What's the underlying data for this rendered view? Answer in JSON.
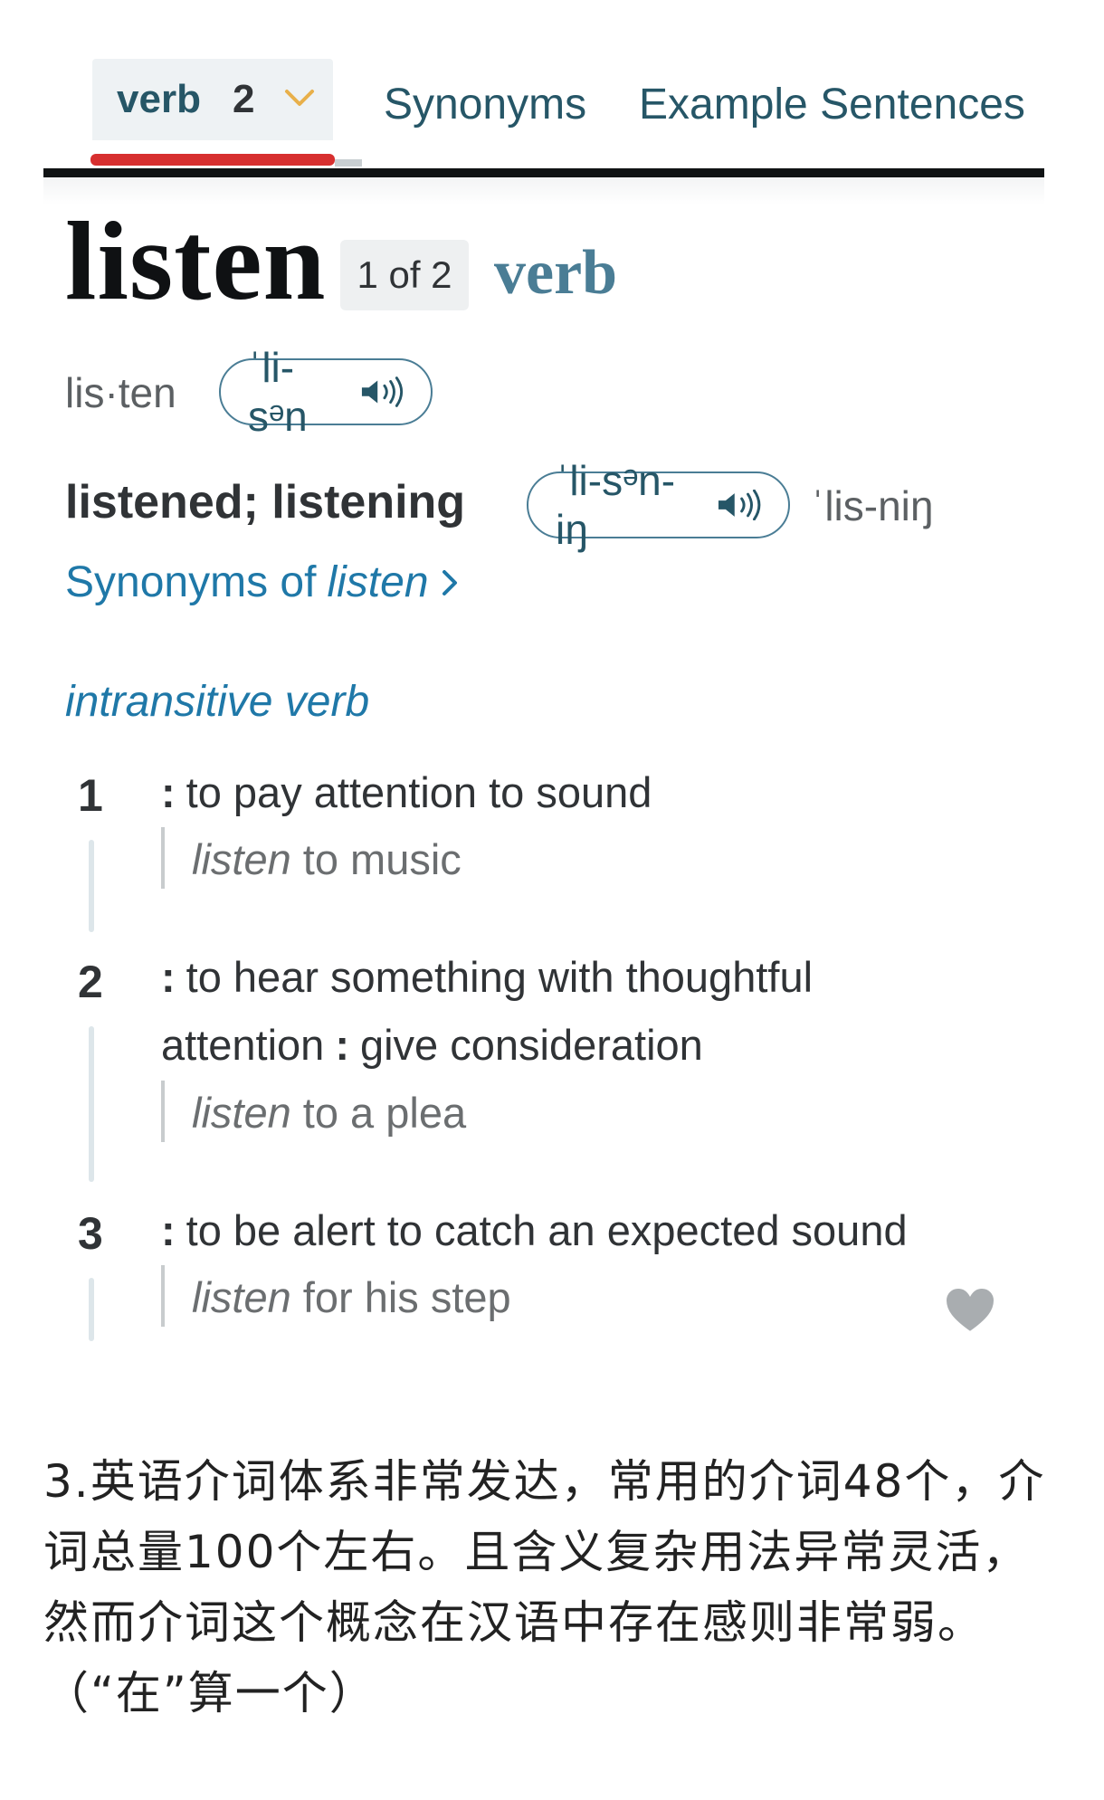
{
  "tabs": {
    "active": {
      "label": "verb",
      "count": "2"
    },
    "synonyms": "Synonyms",
    "examples": "Example Sentences"
  },
  "entry": {
    "headword": "listen",
    "entry_number": "1 of 2",
    "part_of_speech": "verb",
    "syllables": "lis·ten",
    "pronunciation": "ˈli-sᵊn",
    "inflections": "listened; listening",
    "inflection_pronunciation": "ˈli-sᵊn-iŋ",
    "alt_pronunciation": "ˈlis-niŋ",
    "synonyms_link": {
      "prefix": "Synonyms of",
      "word": "listen"
    }
  },
  "senses_label": "intransitive verb",
  "senses": [
    {
      "num": "1",
      "definition": "to pay attention to sound",
      "subdefinition": "",
      "example_word": "listen",
      "example_rest": " to music"
    },
    {
      "num": "2",
      "definition": "to hear something with thoughtful attention",
      "subdefinition": "give consideration",
      "example_word": "listen",
      "example_rest": " to a plea"
    },
    {
      "num": "3",
      "definition": "to be alert to catch an expected sound",
      "subdefinition": "",
      "example_word": "listen",
      "example_rest": " for his step"
    }
  ],
  "caption": "3.英语介词体系非常发达，常用的介词48个，介词总量100个左右。且含义复杂用法异常灵活，然而介词这个概念在汉语中存在感则非常弱。（“在”算一个）",
  "icons": [
    "chevron-down-icon",
    "speaker-icon",
    "chevron-right-icon",
    "heart-icon"
  ],
  "colors": {
    "accent_red": "#d72f2f",
    "link_blue": "#1f78a8",
    "brand_teal": "#265667",
    "pos_blue": "#4a7d95"
  }
}
